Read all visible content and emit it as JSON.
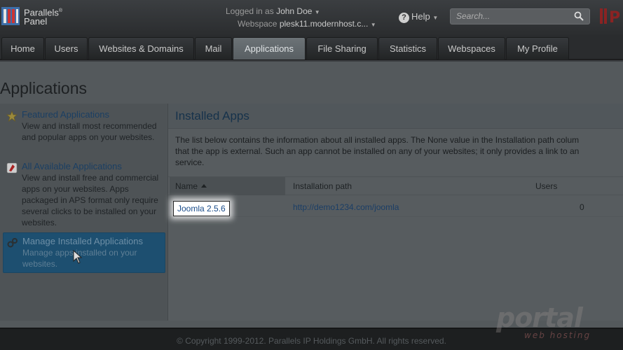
{
  "header": {
    "logo_line1": "Parallels",
    "logo_reg": "®",
    "logo_line2": "Panel",
    "logged_in_label": "Logged in as",
    "user_name": "John Doe",
    "webspace_label": "Webspace",
    "webspace_value": "plesk11.modernhost.c...",
    "help_label": "Help",
    "search_placeholder": "Search..."
  },
  "nav": {
    "tabs": [
      {
        "label": "Home",
        "active": false
      },
      {
        "label": "Users",
        "active": false
      },
      {
        "label": "Websites & Domains",
        "active": false
      },
      {
        "label": "Mail",
        "active": false
      },
      {
        "label": "Applications",
        "active": true
      },
      {
        "label": "File Sharing",
        "active": false
      },
      {
        "label": "Statistics",
        "active": false
      },
      {
        "label": "Webspaces",
        "active": false
      },
      {
        "label": "My Profile",
        "active": false
      }
    ]
  },
  "page": {
    "title": "Applications"
  },
  "sidebar": {
    "items": [
      {
        "title": "Featured Applications",
        "desc": "View and install most recommended and popular apps on your websites.",
        "icon": "star-icon"
      },
      {
        "title": "All Available Applications",
        "desc": "View and install free and commercial apps on your websites. Apps packaged in APS format only require several clicks to be installed on your websites.",
        "icon": "apps-icon"
      },
      {
        "title": "Manage Installed Applications",
        "desc": "Manage apps installed on your websites.",
        "icon": "gears-icon"
      }
    ]
  },
  "main": {
    "heading": "Installed Apps",
    "intro_line1": "The list below contains the information about all installed apps. The None value in the Installation path colum",
    "intro_line2": "that the app is external. Such an app cannot be installed on any of your websites; it only provides a link to an",
    "intro_line3": "service.",
    "columns": {
      "name": "Name",
      "path": "Installation path",
      "users": "Users"
    },
    "rows": [
      {
        "name": "Joomla 2.5.6",
        "path": "http://demo1234.com/joomla",
        "users": "0"
      }
    ]
  },
  "footer": {
    "copyright": "© Copyright 1999-2012. Parallels IP Holdings GmbH. All rights reserved."
  },
  "watermark": {
    "line1": "portal",
    "line2": "web hosting"
  }
}
